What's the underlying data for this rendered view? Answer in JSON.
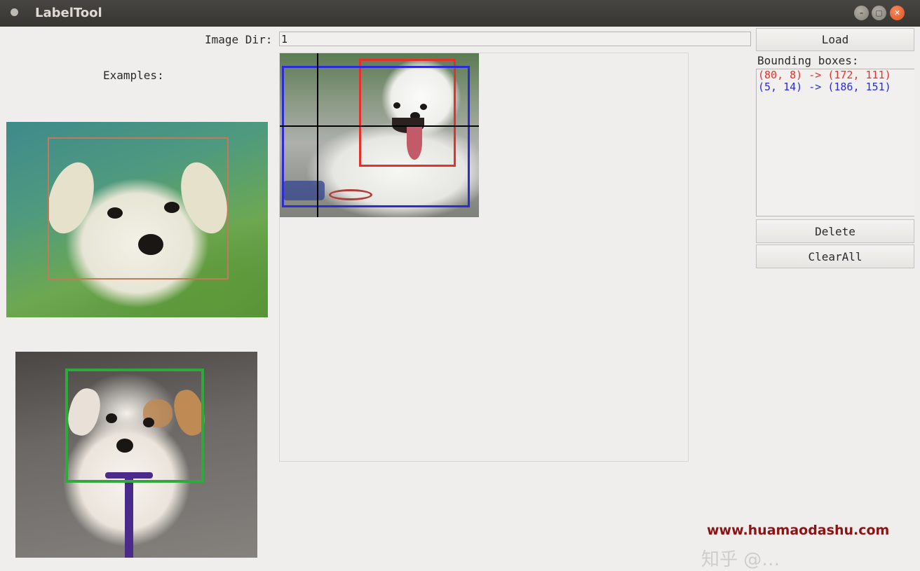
{
  "window": {
    "title": "LabelTool",
    "icon": "app-icon",
    "controls": {
      "minimize": "–",
      "maximize": "▢",
      "close": "✕"
    }
  },
  "toolbar": {
    "image_dir_label": "Image Dir:",
    "image_dir_value": "1",
    "load_label": "Load"
  },
  "examples": {
    "label": "Examples:",
    "items": [
      {
        "name": "white-puppy-green-background",
        "box_color": "#c27b5a"
      },
      {
        "name": "puppy-with-leash",
        "box_color": "#31a83e"
      }
    ]
  },
  "canvas": {
    "image": "samoyed-dog",
    "boxes": [
      {
        "label": "(80, 8) -> (172, 111)",
        "color": "#e8302a"
      },
      {
        "label": "(5, 14) -> (186, 151)",
        "color": "#2b2bd9"
      }
    ],
    "crosshair_color": "#000000"
  },
  "bounding_boxes": {
    "label": "Bounding boxes:",
    "items": [
      {
        "text": "(80, 8) -> (172, 111)",
        "color": "#e8302a"
      },
      {
        "text": "(5, 14) -> (186, 151)",
        "color": "#2b2bd9"
      }
    ]
  },
  "actions": {
    "delete_label": "Delete",
    "clearall_label": "ClearAll"
  },
  "watermark": {
    "text": "www.huamaodashu.com",
    "color": "#8b1515"
  }
}
